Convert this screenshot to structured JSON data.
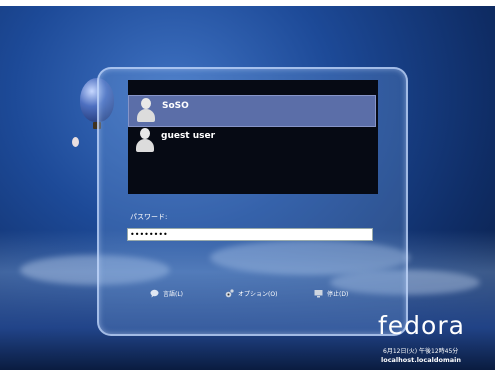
{
  "users": [
    {
      "name": "SoSO",
      "selected": true
    },
    {
      "name": "guest user",
      "selected": false
    }
  ],
  "password": {
    "label": "パスワード:",
    "value": "••••••••"
  },
  "bottom_bar": {
    "language": "言語(L)",
    "options": "オプション(O)",
    "shutdown": "停止(D)"
  },
  "branding": {
    "logo": "fedora",
    "datetime": "6月12日(火) 午後12時45分",
    "hostname": "localhost.localdomain"
  },
  "colors": {
    "selected_row": "#5b6ea8",
    "list_background": "#060a14"
  }
}
